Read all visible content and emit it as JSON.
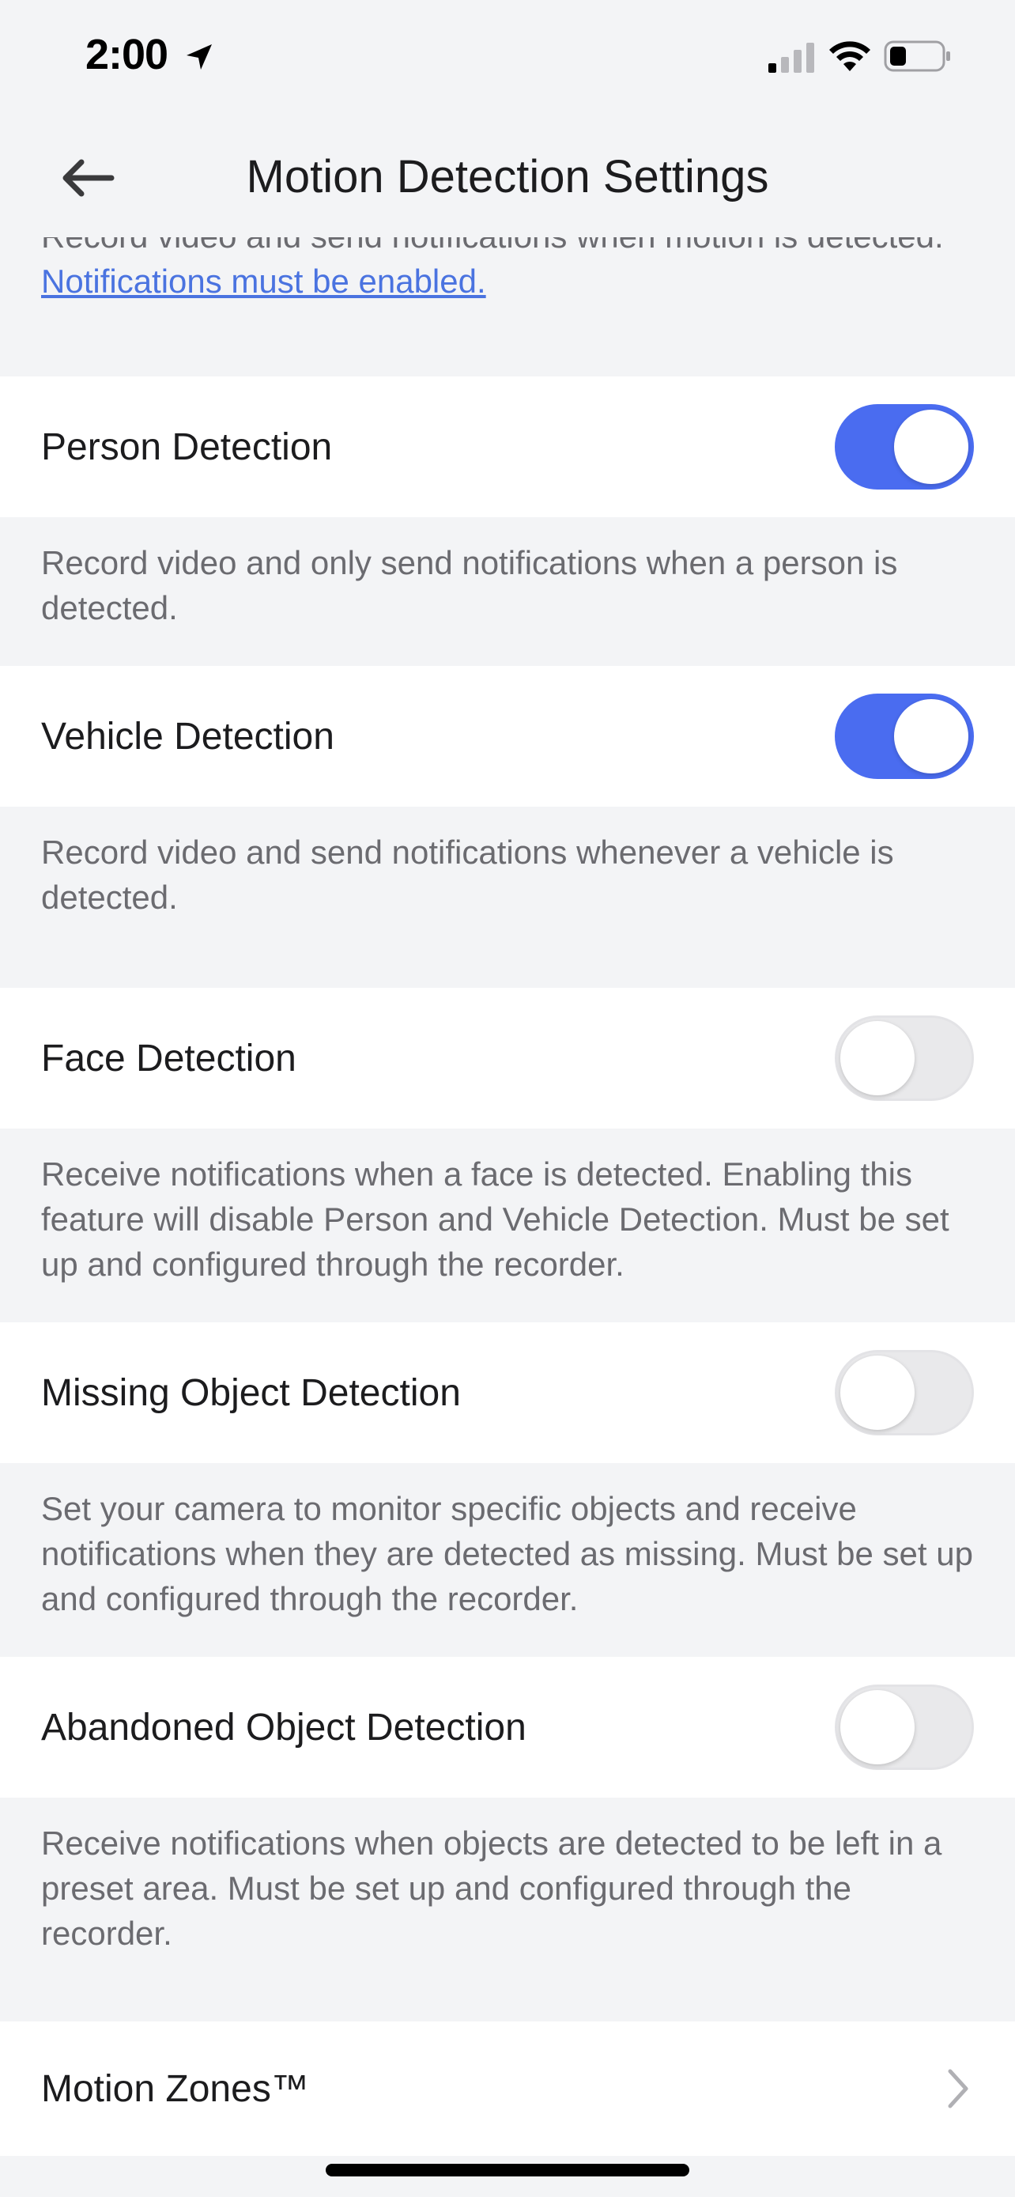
{
  "status_bar": {
    "time": "2:00"
  },
  "header": {
    "title": "Motion Detection Settings"
  },
  "intro": {
    "text": "Record video and send notifications when motion is detected. ",
    "link": "Notifications must be enabled."
  },
  "settings": [
    {
      "label": "Person Detection",
      "enabled": true,
      "description": "Record video and only send notifications when a person is detected."
    },
    {
      "label": "Vehicle Detection",
      "enabled": true,
      "description": "Record video and send notifications whenever a vehicle is detected."
    },
    {
      "label": "Face Detection",
      "enabled": false,
      "description": "Receive notifications when a face is detected. Enabling this feature will disable Person and Vehicle Detection. Must be set up and configured through the recorder."
    },
    {
      "label": "Missing Object Detection",
      "enabled": false,
      "description": "Set your camera to monitor specific objects and receive notifications when they are detected as missing. Must be set up and configured through the recorder."
    },
    {
      "label": "Abandoned Object Detection",
      "enabled": false,
      "description": "Receive notifications when objects are detected to be left in a preset area. Must be set up and configured through the recorder."
    }
  ],
  "motion_zones": {
    "label": "Motion Zones™"
  },
  "colors": {
    "accent": "#4a6cf0",
    "link": "#4a73e0",
    "background": "#f3f4f6"
  }
}
